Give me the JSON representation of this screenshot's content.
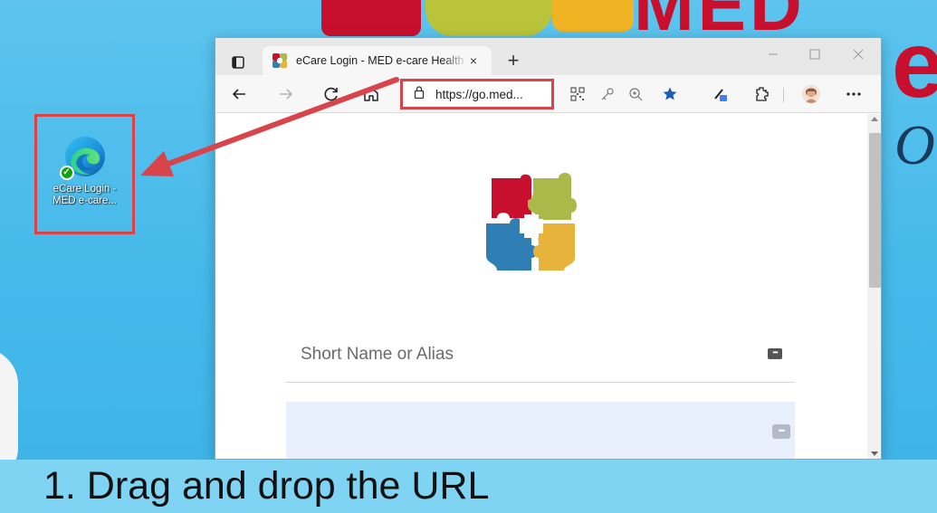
{
  "desktop": {
    "wallpaper": {
      "letters_top": "MED",
      "big_letter": "e",
      "side_letter": "O"
    },
    "shortcut": {
      "label": "eCare Login - MED e-care..."
    }
  },
  "browser": {
    "tab": {
      "title": "eCare Login - MED e-care Health",
      "close_glyph": "×"
    },
    "new_tab_glyph": "+",
    "address": {
      "url": "https://go.med..."
    },
    "page": {
      "field_label": "Short Name or Alias",
      "key_glyph": "•••",
      "password_value": ""
    }
  },
  "caption": "1. Drag and drop the URL",
  "colors": {
    "highlight": "#d9434a",
    "desktop_bg": "#45b9ea",
    "puzzle_red": "#c8102e",
    "puzzle_green": "#a9b94a",
    "puzzle_blue": "#2f7fb5",
    "puzzle_yellow": "#e7b33a",
    "favorite_star": "#1a5fb4"
  },
  "icons": {
    "browser": "edge-icon",
    "lock": "lock-icon",
    "star": "star-icon",
    "arrow": "drag-arrow"
  }
}
